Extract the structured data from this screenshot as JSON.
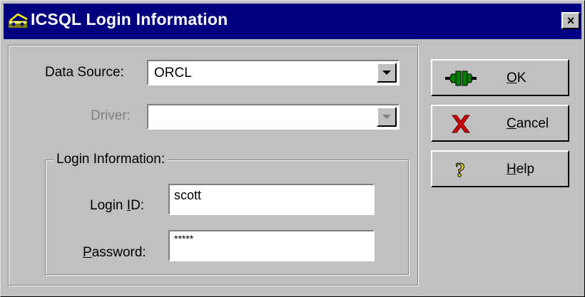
{
  "window": {
    "title": "ICSQL Login Information",
    "close_label": "×"
  },
  "form": {
    "data_source_label": "Data Source:",
    "data_source_value": "ORCL",
    "driver_label": "Driver:",
    "driver_value": "",
    "group_title": "Login Information:",
    "login_id_label_pre": "Login ",
    "login_id_label_mnemonic": "I",
    "login_id_label_post": "D:",
    "login_id_value": "scott",
    "password_label_mnemonic": "P",
    "password_label_post": "assword:",
    "password_value": "*****"
  },
  "buttons": {
    "ok_mnemonic": "O",
    "ok_rest": "K",
    "cancel_mnemonic": "C",
    "cancel_rest": "ancel",
    "help_mnemonic": "H",
    "help_rest": "elp"
  },
  "icons": {
    "title": "key-icon",
    "ok": "plug-connect-icon",
    "cancel": "red-x-icon",
    "help": "question-mark-icon"
  },
  "colors": {
    "titlebar": "#000080",
    "face": "#c0c0c0",
    "cancel_x": "#cc0000",
    "help_q": "#e8d800",
    "ok_plug": "#008000"
  }
}
